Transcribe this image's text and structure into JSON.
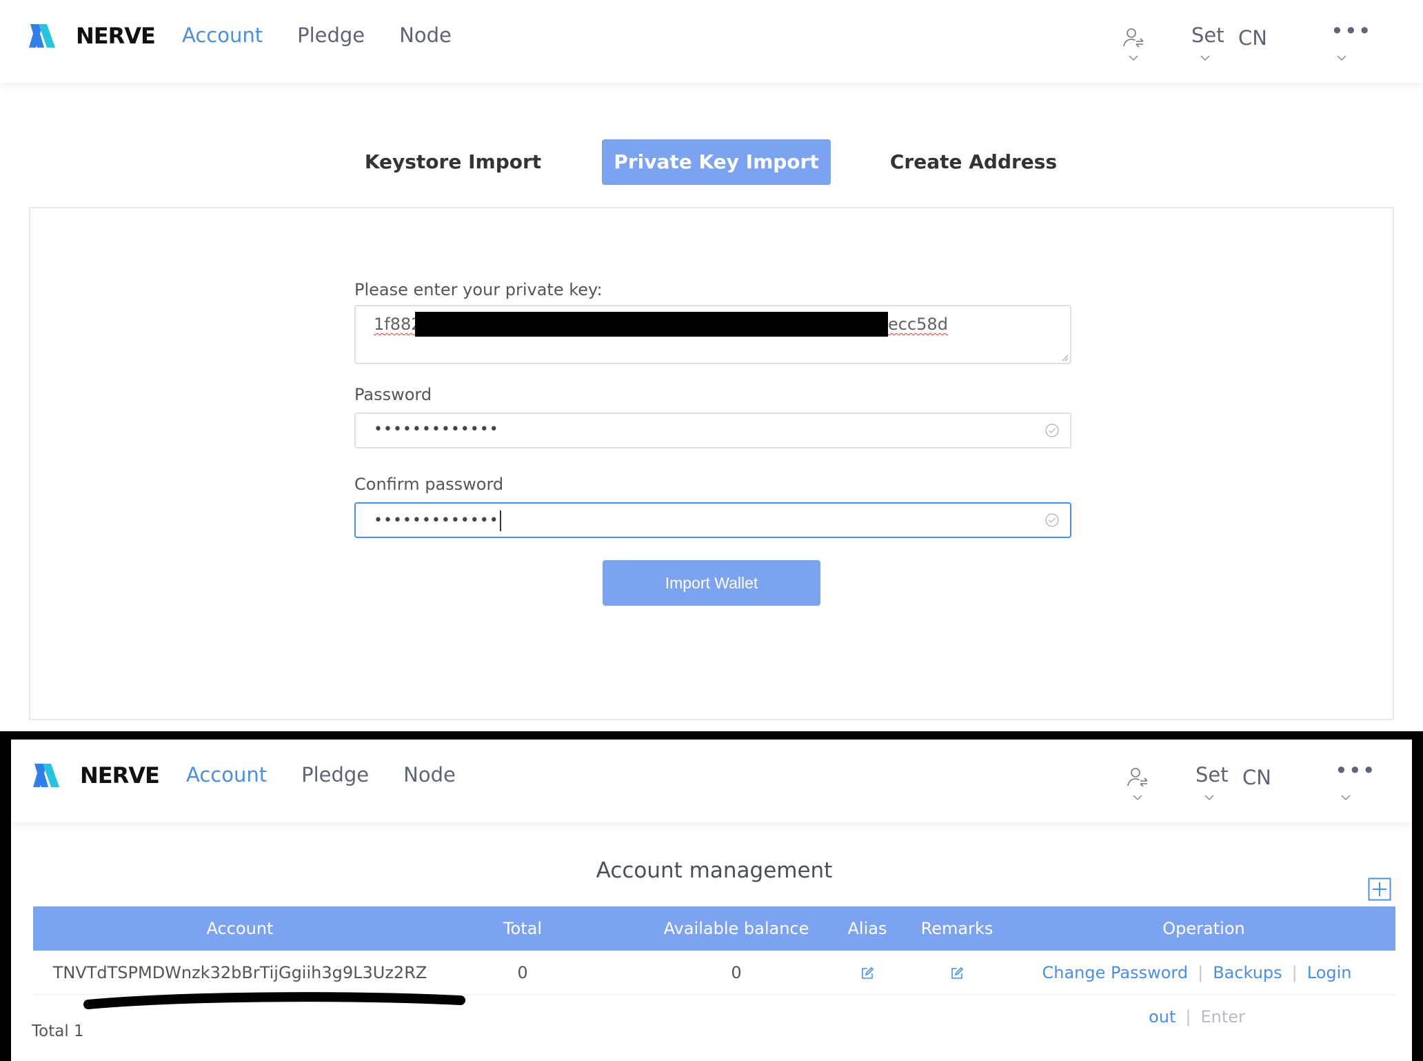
{
  "brand": {
    "name": "NERVE",
    "logo_colors": [
      "#2f80ed",
      "#27c4e0"
    ]
  },
  "nav": {
    "links": [
      "Account",
      "Pledge",
      "Node"
    ],
    "active": "Account",
    "right": {
      "set_label": "Set",
      "lang_label": "CN",
      "user_icon": "user-switch-icon",
      "more_icon": "more-dots-icon"
    }
  },
  "import_page": {
    "tabs": [
      "Keystore Import",
      "Private Key Import",
      "Create Address"
    ],
    "active_tab": "Private Key Import",
    "private_key_label": "Please enter your private key:",
    "private_key_value_start": "1f882",
    "private_key_value_end": "ecc58d",
    "password_label": "Password",
    "password_value": "•••••••••••••",
    "confirm_label": "Confirm password",
    "confirm_value": "•••••••••••••",
    "import_button": "Import Wallet"
  },
  "account_page": {
    "title": "Account management",
    "columns": [
      "Account",
      "Total",
      "Available balance",
      "Alias",
      "Remarks",
      "Operation"
    ],
    "rows": [
      {
        "account": "TNVTdTSPMDWnzk32bBrTijGgiih3g9L3Uz2RZ",
        "total": "0",
        "available": "0",
        "operations": [
          "Change Password",
          "Backups",
          "Login out",
          "Enter"
        ]
      }
    ],
    "total_text": "Total 1"
  },
  "colors": {
    "accent": "#4a8fe7",
    "button": "#7ba3f1",
    "header_bg": "#7ba3f1"
  }
}
